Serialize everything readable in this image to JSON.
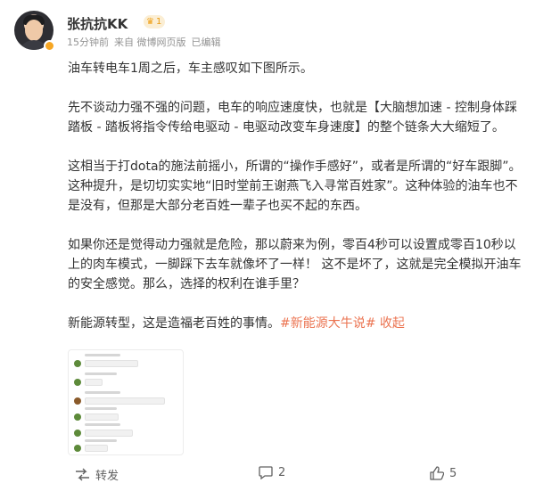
{
  "header": {
    "username": "张抗抗KK",
    "member_level": "1",
    "time": "15分钟前",
    "source": "来自 微博网页版",
    "edited": "已编辑"
  },
  "post": {
    "p1": "油车转电车1周之后，车主感叹如下图所示。",
    "p2": "先不谈动力强不强的问题，电车的响应速度快，也就是【大脑想加速 - 控制身体踩踏板 - 踏板将指令传给电驱动 - 电驱动改变车身速度】的整个链条大大缩短了。",
    "p3": "这相当于打dota的施法前摇小，所谓的“操作手感好”，或者是所谓的“好车跟脚”。这种提升，是切切实实地“旧时堂前王谢燕飞入寻常百姓家”。这种体验的油车也不是没有，但那是大部分老百姓一辈子也买不起的东西。",
    "p4": "如果你还是觉得动力强就是危险，那以蔚来为例，零百4秒可以设置成零百10秒以上的肉车模式，一脚踩下去车就像坏了一样！ 这不是坏了，这就是完全模拟开油车的安全感觉。那么，选择的权利在谁手里？",
    "p5_text": "新能源转型，这是造福老百姓的事情。",
    "hashtag": "#新能源大牛说#",
    "collapse": "收起"
  },
  "actions": {
    "repost_label": "转发",
    "comment_count": "2",
    "like_count": "5"
  },
  "colors": {
    "link": "#eb7350",
    "meta": "#939393",
    "badge": "#f0a21b"
  },
  "icons": [
    "verified-badge-icon",
    "crown-icon",
    "repost-icon",
    "comment-icon",
    "like-icon"
  ]
}
